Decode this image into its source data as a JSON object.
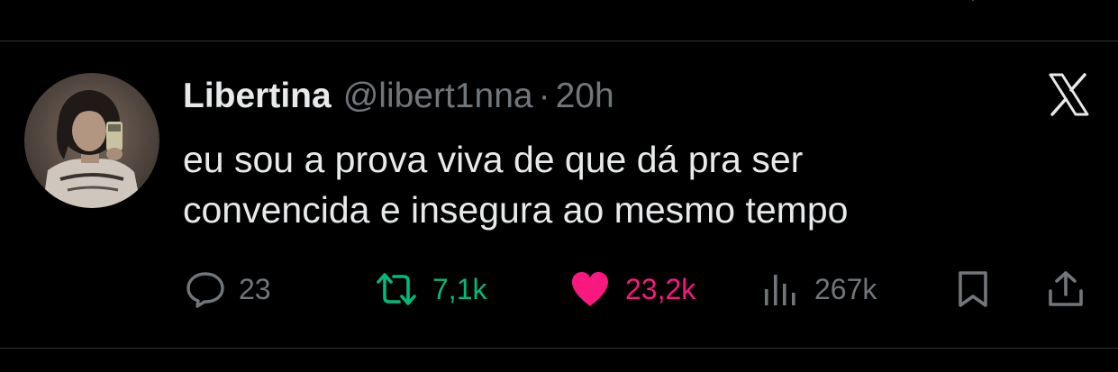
{
  "tweet": {
    "display_name": "Libertina",
    "handle": "@libert1nna",
    "separator": "·",
    "time": "20h",
    "text_lines": [
      "eu sou a prova viva de que dá pra ser",
      "convencida e insegura ao mesmo tempo"
    ]
  },
  "actions": {
    "reply": {
      "icon": "reply-icon",
      "count": "23"
    },
    "retweet": {
      "icon": "retweet-icon",
      "count": "7,1k"
    },
    "like": {
      "icon": "heart-icon",
      "count": "23,2k",
      "liked": true
    },
    "views": {
      "icon": "views-icon",
      "count": "267k"
    },
    "bookmark": {
      "icon": "bookmark-icon"
    },
    "share": {
      "icon": "share-icon"
    }
  },
  "brand": {
    "icon": "x-logo-icon"
  },
  "colors": {
    "background": "#000000",
    "text": "#e7e9ea",
    "muted": "#71767b",
    "retweet": "#00ba7c",
    "like": "#f91880",
    "divider": "#2f3336"
  }
}
